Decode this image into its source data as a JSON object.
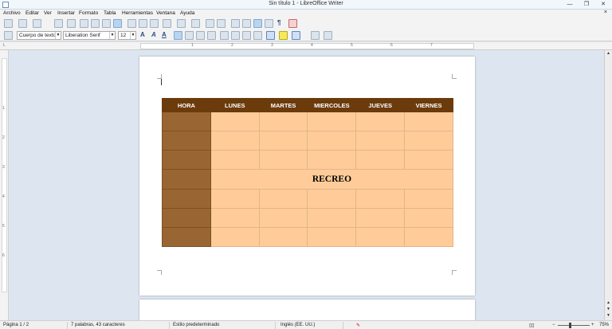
{
  "window": {
    "title": "Sin título 1 - LibreOffice Writer",
    "minimize": "—",
    "maximize": "❐",
    "close": "✕"
  },
  "menu": [
    "Archivo",
    "Editar",
    "Ver",
    "Insertar",
    "Formato",
    "Tabla",
    "Herramientas",
    "Ventana",
    "Ayuda"
  ],
  "menu_close": "×",
  "formatting": {
    "paragraph_style": "Cuerpo de texto",
    "font_name": "Liberation Serif",
    "font_size": "12"
  },
  "ruler": {
    "h_label": "L",
    "numbers": [
      "1",
      "2",
      "3",
      "4",
      "5",
      "6",
      "7"
    ]
  },
  "table": {
    "headers": [
      "HORA",
      "LUNES",
      "MARTES",
      "MIERCOLES",
      "JUEVES",
      "VIERNES"
    ],
    "recreo": "RECREO"
  },
  "status": {
    "page": "Página 1 / 2",
    "words": "7 palabras, 43 caracteres",
    "style": "Estilo predeterminado",
    "language": "Inglés (EE. UU.)",
    "zoom": "75%",
    "zoom_level": 0.75
  },
  "colors": {
    "header": "#6b3b0c",
    "hora_column": "#996633",
    "cells": "#ffcc99"
  }
}
